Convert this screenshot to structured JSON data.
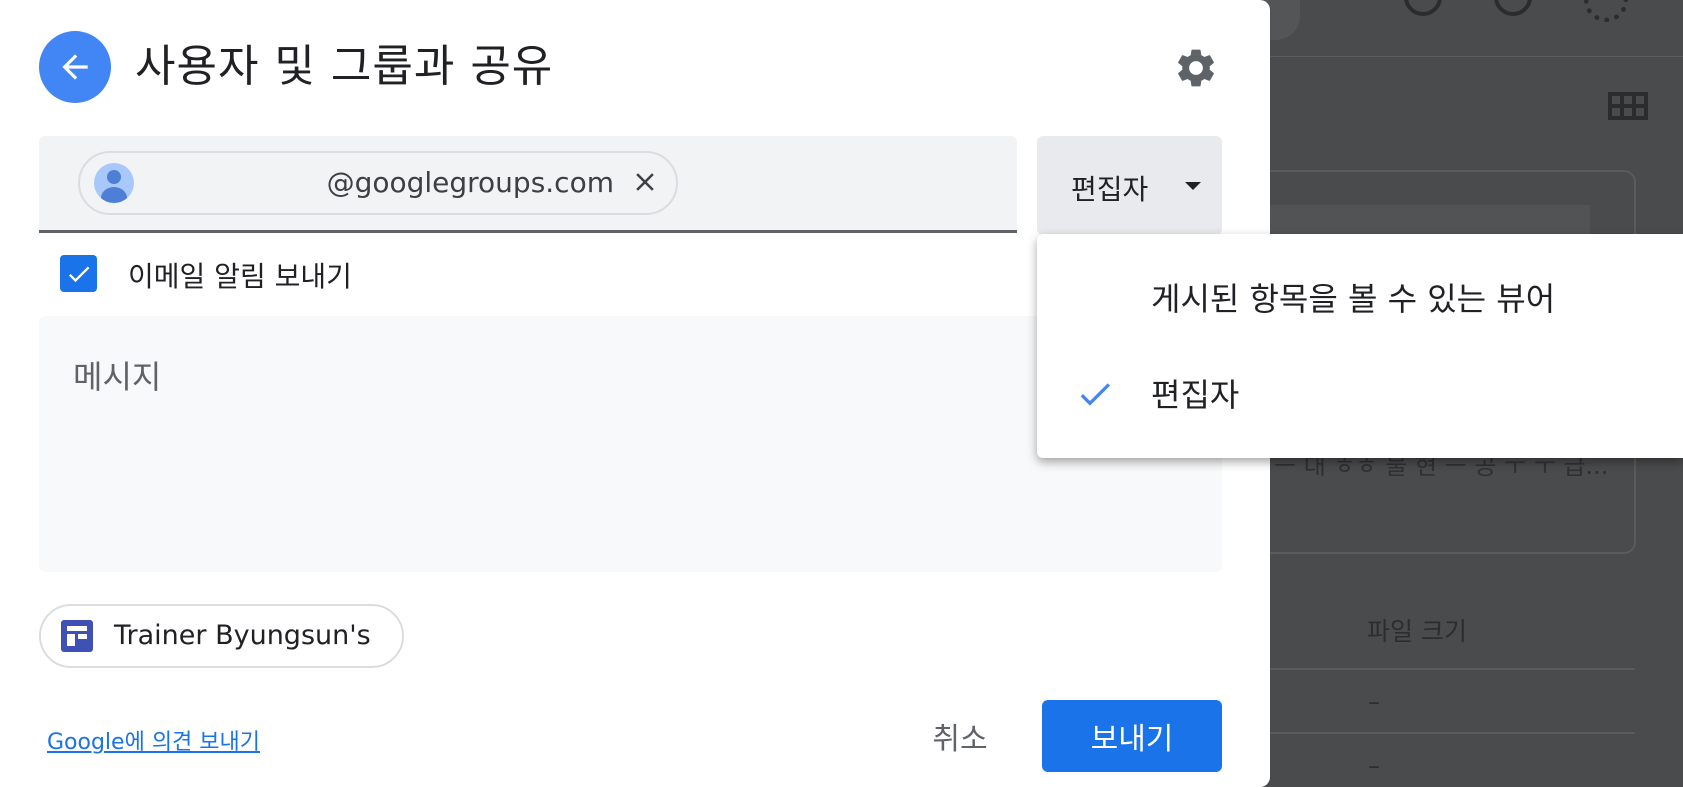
{
  "dialog": {
    "title": "사용자 및 그룹과 공유",
    "recipient_email": "@googlegroups.com",
    "role_selected": "편집자",
    "notify_label": "이메일 알림 보내기",
    "notify_checked": true,
    "message_placeholder": "메시지",
    "file_name": "Trainer Byungsun's",
    "feedback_link": "Google에 의견 보내기",
    "cancel_label": "취소",
    "send_label": "보내기"
  },
  "role_menu": {
    "items": [
      {
        "label": "게시된 항목을 볼 수 있는 뷰어",
        "selected": false
      },
      {
        "label": "편집자",
        "selected": true
      }
    ]
  },
  "background": {
    "column_header": "파일 크기",
    "snippet": "ㅡ 대 ㅎㅎ 물 현 ㅡ 공 ㅜ ㅜ 급...",
    "dash": "–"
  },
  "colors": {
    "accent": "#1a73e8",
    "back_button": "#4285f4",
    "file_icon": "#3f51b5"
  },
  "icons": {
    "back": "arrow-left-icon",
    "settings": "gear-icon",
    "remove": "close-icon",
    "caret": "caret-down-icon",
    "check": "checkmark-icon",
    "avatar": "person-avatar-icon",
    "file": "google-sites-icon"
  }
}
